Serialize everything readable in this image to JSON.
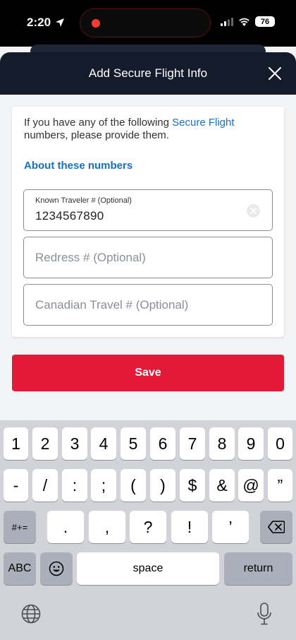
{
  "status_bar": {
    "time": "2:20",
    "battery": "76"
  },
  "header": {
    "title": "Add Secure Flight Info",
    "close_icon": "close-icon"
  },
  "card": {
    "intro_before": "If you have any of the following ",
    "intro_link": "Secure Flight",
    "intro_after": " numbers, please provide them.",
    "about_link": "About these numbers",
    "known_traveler": {
      "label": "Known Traveler # (Optional)",
      "value": "1234567890"
    },
    "redress": {
      "placeholder": "Redress # (Optional)"
    },
    "canadian": {
      "placeholder": "Canadian Travel # (Optional)"
    }
  },
  "save_label": "Save",
  "keyboard": {
    "row1": [
      "1",
      "2",
      "3",
      "4",
      "5",
      "6",
      "7",
      "8",
      "9",
      "0"
    ],
    "row2": [
      "-",
      "/",
      ":",
      ";",
      "(",
      ")",
      "$",
      "&",
      "@",
      "”"
    ],
    "row3": [
      "#+=",
      ".",
      ",",
      "?",
      "!",
      "’"
    ],
    "abc": "ABC",
    "space": "space",
    "return": "return",
    "icons": [
      "backspace-icon",
      "emoji-icon",
      "globe-icon",
      "microphone-icon"
    ]
  },
  "colors": {
    "header_bg": "#141c2c",
    "accent_link": "#1a6fc4",
    "save_bg": "#e31937",
    "keyboard_bg": "#d1d3d9"
  }
}
